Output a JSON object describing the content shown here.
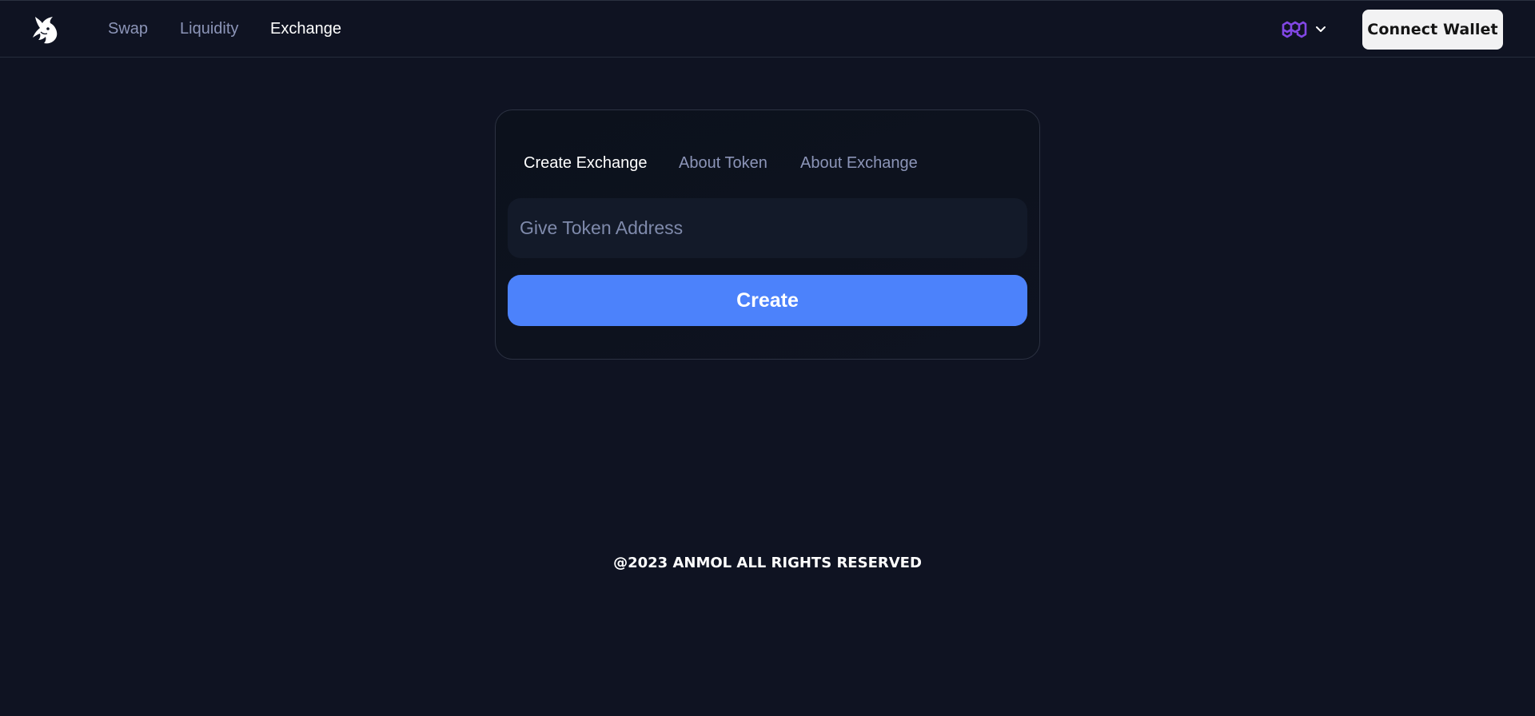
{
  "nav": {
    "logo_icon": "unicorn-logo-icon",
    "links": [
      {
        "label": "Swap",
        "active": false
      },
      {
        "label": "Liquidity",
        "active": false
      },
      {
        "label": "Exchange",
        "active": true
      }
    ],
    "network_icon": "polygon-icon",
    "network_color": "#8247e5",
    "connect_wallet_label": "Connect Wallet"
  },
  "card": {
    "tabs": [
      {
        "label": "Create Exchange",
        "active": true
      },
      {
        "label": "About Token",
        "active": false
      },
      {
        "label": "About Exchange",
        "active": false
      }
    ],
    "token_address": {
      "value": "",
      "placeholder": "Give Token Address"
    },
    "create_label": "Create",
    "accent_color": "#4c82fb"
  },
  "footer": {
    "text": "@2023 ANMOL ALL RIGHTS RESERVED"
  }
}
